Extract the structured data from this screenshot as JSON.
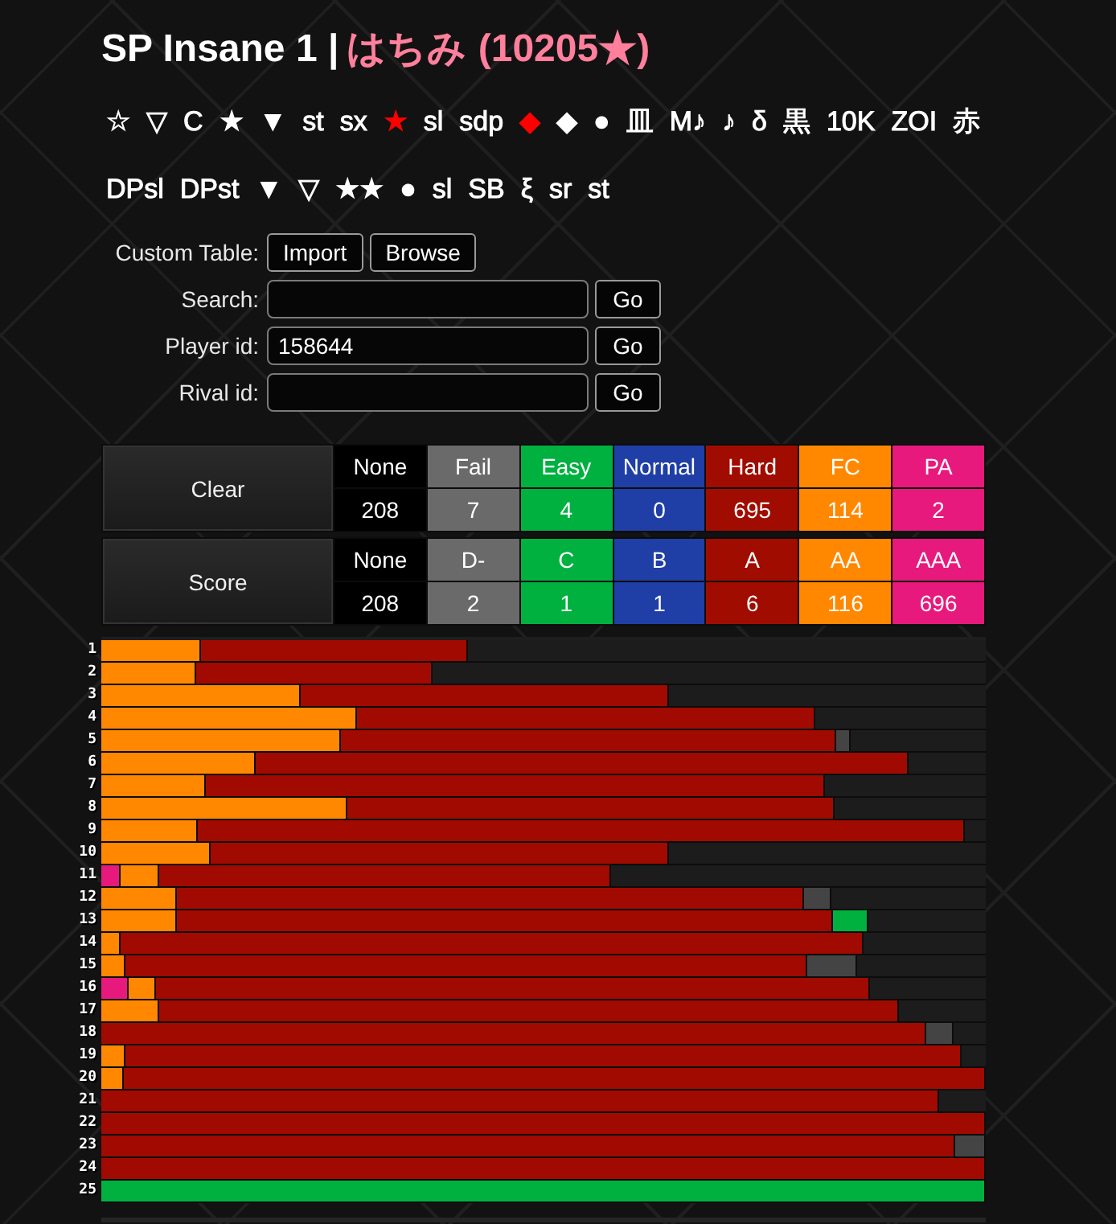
{
  "title": "SP Insane 1 |",
  "player": "はちみ (10205★)",
  "table_links": {
    "rows": [
      {
        "items": [
          {
            "text": "☆",
            "color": "#ffffff"
          },
          {
            "text": "▽",
            "color": "#ffffff"
          },
          {
            "text": "C",
            "color": "#ffffff"
          },
          {
            "text": "★",
            "color": "#ffffff"
          },
          {
            "text": "▼",
            "color": "#ffffff"
          },
          {
            "text": "st",
            "color": "#ffffff"
          },
          {
            "text": "sx",
            "color": "#ffffff"
          },
          {
            "text": "★",
            "color": "#ff0000"
          },
          {
            "text": "sl",
            "color": "#ffffff"
          },
          {
            "text": "sdp",
            "color": "#ffffff"
          },
          {
            "text": "◆",
            "color": "#ff0000"
          },
          {
            "text": "◆",
            "color": "#ffffff"
          },
          {
            "text": "●",
            "color": "#ffffff"
          },
          {
            "text": "皿",
            "color": "#ffffff"
          },
          {
            "text": "M♪",
            "color": "#ffffff"
          },
          {
            "text": "♪",
            "color": "#ffffff"
          },
          {
            "text": "δ",
            "color": "#ffffff"
          },
          {
            "text": "黒",
            "color": "#ffffff"
          },
          {
            "text": "10K",
            "color": "#ffffff"
          },
          {
            "text": "ZOI",
            "color": "#ffffff"
          },
          {
            "text": "赤",
            "color": "#ffffff"
          }
        ]
      },
      {
        "items": [
          {
            "text": "DPsl",
            "color": "#ffffff"
          },
          {
            "text": "DPst",
            "color": "#ffffff"
          },
          {
            "text": "▼",
            "color": "#ffffff"
          },
          {
            "text": "▽",
            "color": "#ffffff"
          },
          {
            "text": "★★",
            "color": "#ffffff"
          },
          {
            "text": "●",
            "color": "#ffffff"
          },
          {
            "text": "sl",
            "color": "#ffffff"
          },
          {
            "text": "SB",
            "color": "#ffffff"
          },
          {
            "text": "ξ",
            "color": "#ffffff"
          },
          {
            "text": "sr",
            "color": "#ffffff"
          },
          {
            "text": "st",
            "color": "#ffffff"
          }
        ]
      }
    ]
  },
  "custom_table": {
    "label": "Custom Table:",
    "buttons": [
      "Import",
      "Browse"
    ]
  },
  "fields": [
    {
      "label": "Search:",
      "button": "Go"
    },
    {
      "label": "Player id:",
      "value": "158644",
      "button": "Go"
    },
    {
      "label": "Rival id:",
      "button": "Go"
    }
  ],
  "summary": [
    {
      "title": "Clear",
      "columns": [
        {
          "label": "None",
          "count": "208",
          "color": "#000000"
        },
        {
          "label": "Fail",
          "count": "7",
          "color": "#6a6a6a"
        },
        {
          "label": "Easy",
          "count": "4",
          "color": "#00b140"
        },
        {
          "label": "Normal",
          "count": "0",
          "color": "#1f3fa6"
        },
        {
          "label": "Hard",
          "count": "695",
          "color": "#a00c00"
        },
        {
          "label": "FC",
          "count": "114",
          "color": "#ff8800"
        },
        {
          "label": "PA",
          "count": "2",
          "color": "#e8197c"
        }
      ]
    },
    {
      "title": "Score",
      "columns": [
        {
          "label": "None",
          "count": "208",
          "color": "#000000"
        },
        {
          "label": "D-",
          "count": "2",
          "color": "#6a6a6a"
        },
        {
          "label": "C",
          "count": "1",
          "color": "#00b140"
        },
        {
          "label": "B",
          "count": "1",
          "color": "#1f3fa6"
        },
        {
          "label": "A",
          "count": "6",
          "color": "#a00c00"
        },
        {
          "label": "AA",
          "count": "116",
          "color": "#ff8800"
        },
        {
          "label": "AAA",
          "count": "696",
          "color": "#e8197c"
        }
      ]
    }
  ],
  "clear_bars": {
    "rows": [
      {
        "label": "1"
      },
      {
        "label": "2"
      },
      {
        "label": "3"
      },
      {
        "label": "4"
      },
      {
        "label": "5"
      },
      {
        "label": "6"
      },
      {
        "label": "7"
      },
      {
        "label": "8"
      },
      {
        "label": "9"
      },
      {
        "label": "10"
      },
      {
        "label": "11"
      },
      {
        "label": "12"
      },
      {
        "label": "13"
      },
      {
        "label": "14"
      },
      {
        "label": "15"
      },
      {
        "label": "16"
      },
      {
        "label": "17"
      },
      {
        "label": "18"
      },
      {
        "label": "19"
      },
      {
        "label": "20"
      },
      {
        "label": "21"
      },
      {
        "label": "22"
      },
      {
        "label": "23"
      },
      {
        "label": "24"
      },
      {
        "label": "25"
      }
    ]
  }
}
